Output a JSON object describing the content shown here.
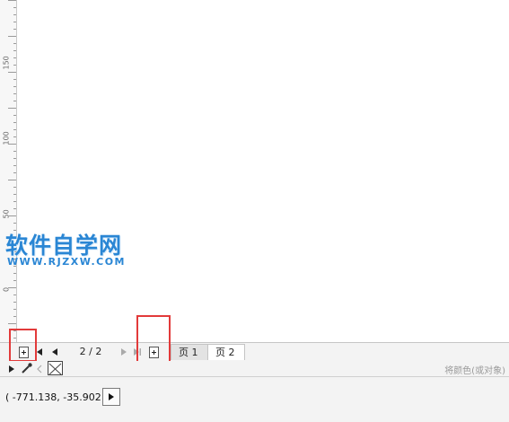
{
  "ruler": {
    "labels": [
      "150",
      "100",
      "50",
      "0"
    ]
  },
  "watermark": {
    "title": "软件自学网",
    "url": "WWW.RJZXW.COM",
    "color": "#2a86d4"
  },
  "page_navigator": {
    "page_count": "2 / 2",
    "tabs": [
      {
        "label": "页 1",
        "active": false
      },
      {
        "label": "页 2",
        "active": true
      }
    ],
    "highlight_color": "#e23a3a"
  },
  "palette": {
    "hint": "将颜色(或对象)"
  },
  "status": {
    "coordinates": "( -771.138, -35.902 )"
  }
}
